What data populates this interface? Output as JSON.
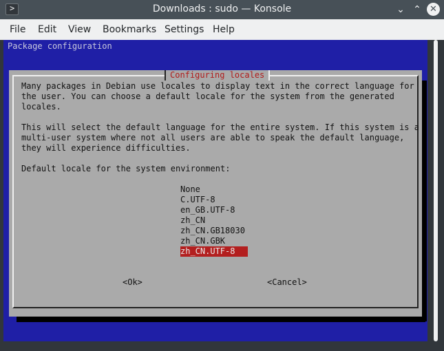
{
  "window": {
    "title": "Downloads : sudo — Konsole",
    "app_icon_glyph": ">",
    "minimize_glyph": "⌄",
    "maximize_glyph": "⌃",
    "close_glyph": "✕"
  },
  "menubar": {
    "items": [
      "File",
      "Edit",
      "View",
      "Bookmarks",
      "Settings",
      "Help"
    ]
  },
  "terminal": {
    "package_title": "Package configuration",
    "dialog": {
      "title": "Configuring locales",
      "lines": [
        "Many packages in Debian use locales to display text in the correct language for",
        "the user. You can choose a default locale for the system from the generated",
        "locales.",
        "",
        "This will select the default language for the entire system. If this system is a",
        "multi-user system where not all users are able to speak the default language,",
        "they will experience difficulties.",
        "",
        "Default locale for the system environment:"
      ],
      "locales": [
        "None",
        "C.UTF-8",
        "en_GB.UTF-8",
        "zh_CN",
        "zh_CN.GB18030",
        "zh_CN.GBK",
        "zh_CN.UTF-8"
      ],
      "selected_locale": "zh_CN.UTF-8",
      "ok_label": "<Ok>",
      "cancel_label": "<Cancel>"
    }
  },
  "colors": {
    "terminal_background": "#1f1fa6",
    "dialog_background": "#aaaaaa",
    "selection": "#b31f1f",
    "dialog_title_text": "#b01c1c"
  }
}
